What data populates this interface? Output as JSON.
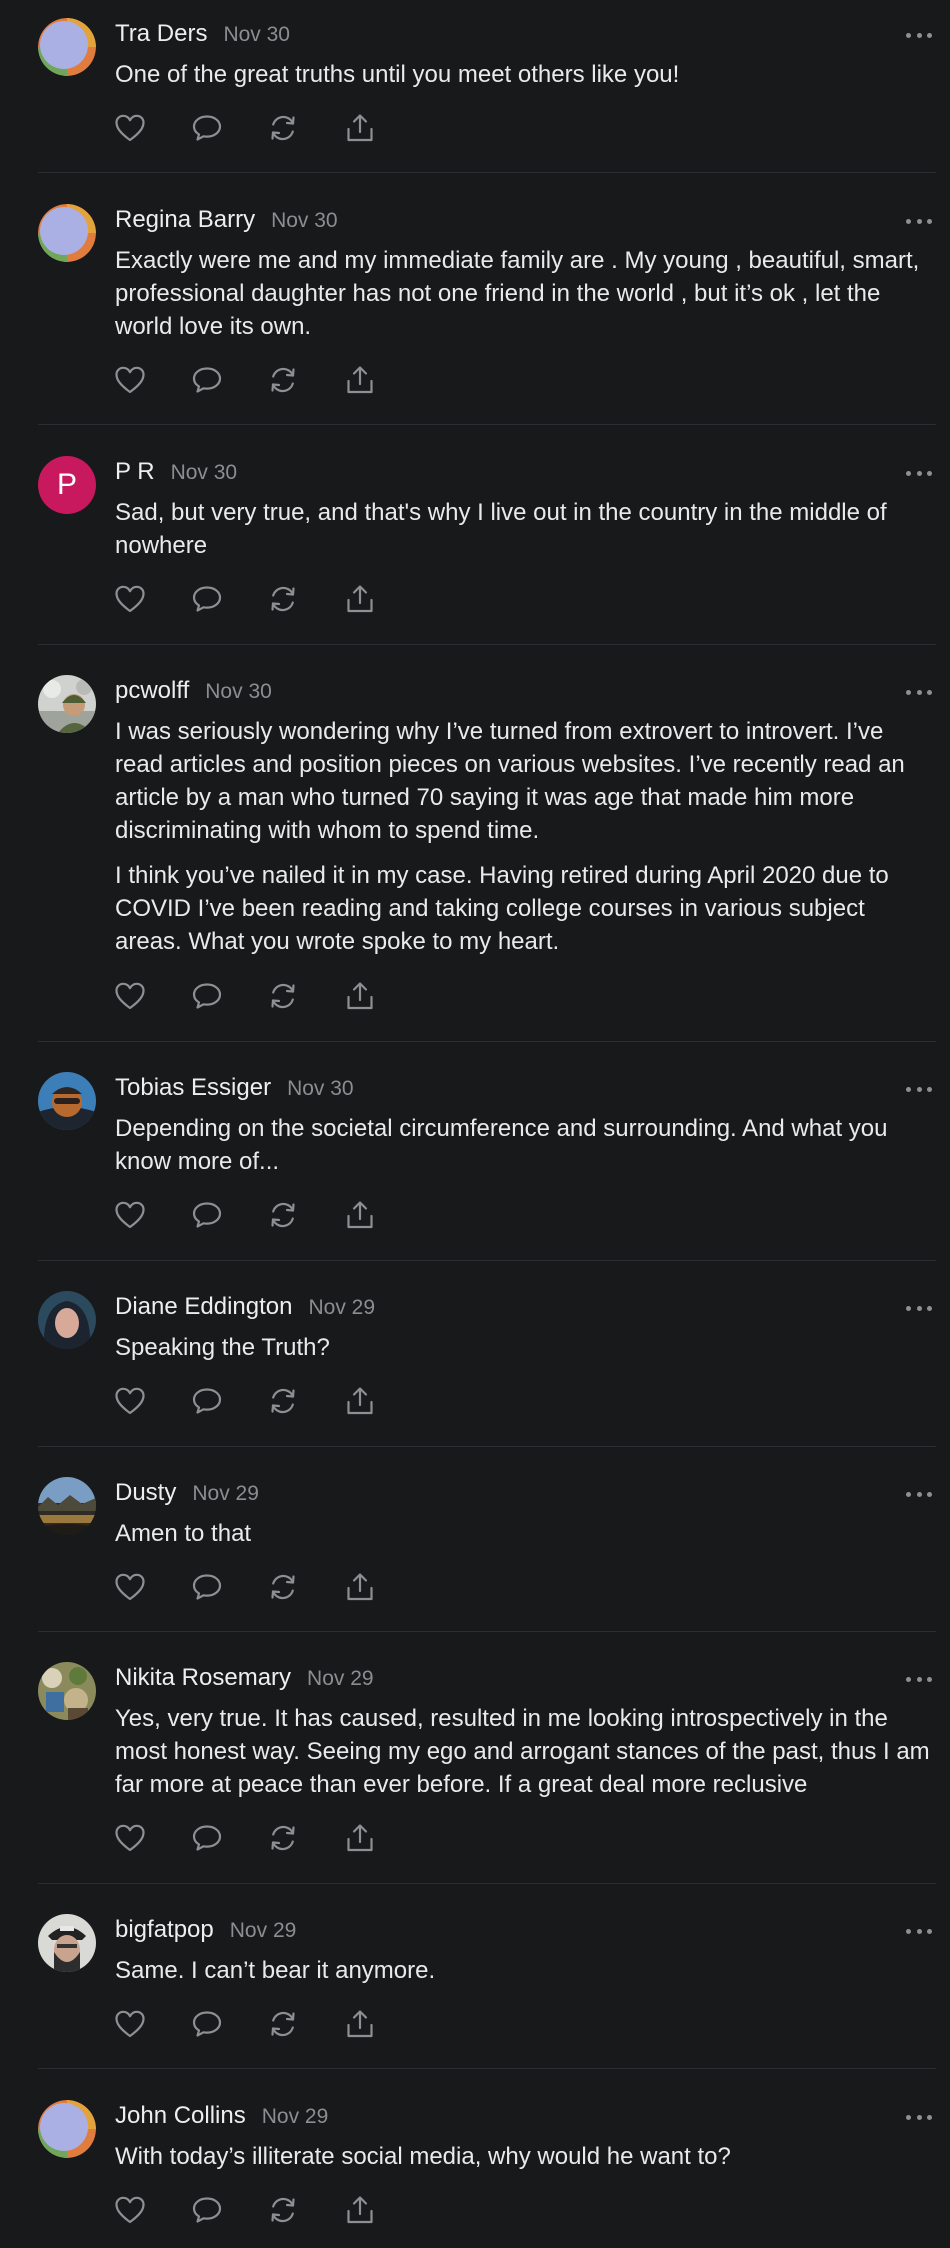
{
  "comments": [
    {
      "name": "Tra Ders",
      "date": "Nov 30",
      "paragraphs": [
        "One of the great truths until you meet others like you!"
      ],
      "avatar_icon": "gradient-circle-avatar"
    },
    {
      "name": "Regina Barry",
      "date": "Nov 30",
      "paragraphs": [
        "Exactly were me and my immediate family are . My young , beautiful, smart, professional daughter has not one friend in the world , but it’s ok , let the world love its own."
      ],
      "avatar_icon": "gradient-circle-avatar"
    },
    {
      "name": "P R",
      "date": "Nov 30",
      "paragraphs": [
        "Sad, but very true, and that's why I live out in the country in the middle of nowhere"
      ],
      "avatar_letter": "P",
      "avatar_color": "#c8195e"
    },
    {
      "name": "pcwolff",
      "date": "Nov 30",
      "paragraphs": [
        "I was seriously wondering why I’ve turned from extrovert to introvert. I’ve read articles and position pieces on various websites. I’ve recently read an article by a man who turned 70 saying it was age that made him more discriminating with whom to spend time.",
        "I think you’ve nailed it in my case. Having retired during April 2020 due to COVID I’ve been reading and taking college courses in various subject areas. What you wrote spoke to my heart."
      ],
      "avatar_icon": "photo-avatar"
    },
    {
      "name": "Tobias Essiger",
      "date": "Nov 30",
      "paragraphs": [
        "Depending on the societal circumference and surrounding. And what you know more of..."
      ],
      "avatar_icon": "photo-avatar"
    },
    {
      "name": "Diane Eddington",
      "date": "Nov 29",
      "paragraphs": [
        "Speaking the Truth?"
      ],
      "avatar_icon": "photo-avatar"
    },
    {
      "name": "Dusty",
      "date": "Nov 29",
      "paragraphs": [
        "Amen to that"
      ],
      "avatar_icon": "photo-avatar"
    },
    {
      "name": "Nikita Rosemary",
      "date": "Nov 29",
      "paragraphs": [
        "Yes, very true. It has caused, resulted in me looking introspectively in the most honest way. Seeing my ego and arrogant stances of the past, thus I am far more at peace than ever before. If a great deal more reclusive"
      ],
      "avatar_icon": "photo-avatar"
    },
    {
      "name": "bigfatpop",
      "date": "Nov 29",
      "paragraphs": [
        "Same. I can’t bear it anymore."
      ],
      "avatar_icon": "photo-avatar"
    },
    {
      "name": "John Collins",
      "date": "Nov 29",
      "paragraphs": [
        "With today’s illiterate social media, why would he want to?"
      ],
      "avatar_icon": "gradient-circle-avatar"
    }
  ],
  "action_icons": [
    "heart-icon",
    "comment-icon",
    "restack-icon",
    "share-icon"
  ],
  "more_icon": "more-options-icon",
  "colors": {
    "background": "#18191b",
    "text": "#eaeaec",
    "muted": "#8c8d90",
    "divider": "#2d2e31"
  }
}
